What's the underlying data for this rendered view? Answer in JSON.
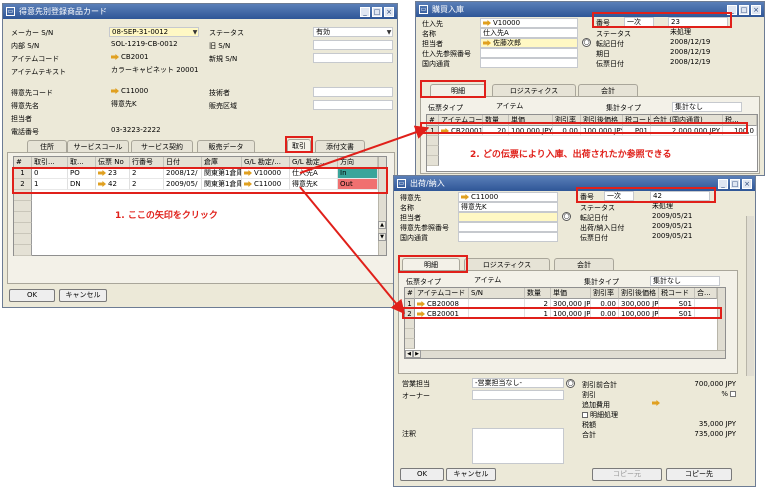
{
  "w1": {
    "title": "得意先別登録商品カード",
    "fields": [
      {
        "l": "メーカー S/N",
        "v": "08-SEP-31-0012",
        "style": "yellow",
        "arrow": false
      },
      {
        "l": "内部 S/N",
        "v": "SOL-1219-CB-0012",
        "style": "plain",
        "arrow": false
      },
      {
        "l": "アイテムコード",
        "v": "CB2001",
        "style": "plain",
        "arrow": true
      },
      {
        "l": "アイテムテキスト",
        "v": "カラーキャビネット 20001",
        "style": "plain",
        "arrow": false
      },
      {
        "l": "得意先コード",
        "v": "C11000",
        "style": "plain",
        "arrow": true
      },
      {
        "l": "得意先名",
        "v": "得意先K",
        "style": "plain",
        "arrow": false
      },
      {
        "l": "担当者",
        "v": "",
        "style": "plain",
        "arrow": false
      },
      {
        "l": "電話番号",
        "v": "03-3223-2222",
        "style": "plain",
        "arrow": false
      }
    ],
    "rfields": [
      {
        "l": "ステータス",
        "v": "有効"
      },
      {
        "l": "旧 S/N",
        "v": ""
      },
      {
        "l": "新規 S/N",
        "v": ""
      },
      {
        "l": "技術者",
        "v": ""
      },
      {
        "l": "販売区域",
        "v": ""
      }
    ],
    "tabs": [
      "住所",
      "サービスコール",
      "サービス契約",
      "販売データ",
      "取引",
      "添付文書"
    ],
    "cols": [
      "#",
      "取引...",
      "取...",
      "伝票 No",
      "行番号",
      "日付",
      "倉庫",
      "G/L 勘定/...",
      "G/L 勘定...",
      "方向"
    ],
    "rows": [
      {
        "n": "1",
        "c": [
          "0",
          "PO",
          "23",
          "2",
          "2008/12/",
          "関東第1倉庫",
          "V10000",
          "仕入先A",
          "In"
        ]
      },
      {
        "n": "2",
        "c": [
          "1",
          "DN",
          "42",
          "2",
          "2009/05/",
          "関東第1倉庫",
          "C11000",
          "得意先K",
          "Out"
        ]
      }
    ],
    "ok": "OK",
    "cancel": "キャンセル"
  },
  "w2": {
    "title": "購買入庫",
    "fields": [
      {
        "l": "仕入先",
        "v": "V10000",
        "arrow": true
      },
      {
        "l": "名称",
        "v": "仕入先A",
        "arrow": false
      },
      {
        "l": "担当者",
        "v": "佐藤次郎",
        "arrow": true
      },
      {
        "l": "仕入先参照番号",
        "v": "",
        "arrow": false
      },
      {
        "l": "国内通貨",
        "v": "",
        "arrow": false
      }
    ],
    "doc": {
      "l": "番号",
      "s": "一次",
      "v": "23"
    },
    "rfields": [
      {
        "l": "ステータス",
        "v": "未処理"
      },
      {
        "l": "転記日付",
        "v": "2008/12/19"
      },
      {
        "l": "期日",
        "v": "2008/12/19"
      },
      {
        "l": "伝票日付",
        "v": "2008/12/19"
      }
    ],
    "tabs": [
      "明細",
      "ロジスティクス",
      "会計"
    ],
    "doctype_l": "伝票タイプ",
    "doctype_v": "アイテム",
    "sum_l": "集計タイプ",
    "sum_v": "集計なし",
    "cols": [
      "#",
      "アイテムコード",
      "数量",
      "単価",
      "割引率",
      "割引後価格",
      "税コード",
      "合計 (国内通貨)",
      "税..."
    ],
    "row": {
      "n": "1",
      "c": [
        "CB20001",
        "20",
        "100,000 JPY",
        "0.00",
        "100,000 JPY",
        "P01",
        "2,000,000 JPY",
        "100,0"
      ]
    }
  },
  "w3": {
    "title": "出荷/納入",
    "fields": [
      {
        "l": "得意先",
        "v": "C11000",
        "arrow": true
      },
      {
        "l": "名称",
        "v": "得意先K",
        "arrow": false
      },
      {
        "l": "担当者",
        "v": "",
        "arrow": false
      },
      {
        "l": "得意先参照番号",
        "v": "",
        "arrow": false
      },
      {
        "l": "国内通貨",
        "v": "",
        "arrow": false
      }
    ],
    "doc": {
      "l": "番号",
      "s": "一次",
      "v": "42"
    },
    "rfields": [
      {
        "l": "ステータス",
        "v": "未処理"
      },
      {
        "l": "転記日付",
        "v": "2009/05/21"
      },
      {
        "l": "出荷/納入日付",
        "v": "2009/05/21"
      },
      {
        "l": "伝票日付",
        "v": "2009/05/21"
      }
    ],
    "tabs": [
      "明細",
      "ロジスティクス",
      "会計"
    ],
    "doctype_l": "伝票タイプ",
    "doctype_v": "アイテム",
    "sum_l": "集計タイプ",
    "sum_v": "集計なし",
    "cols": [
      "#",
      "アイテムコード",
      "S/N",
      "数量",
      "単価",
      "割引率",
      "割引後価格",
      "税コード",
      "合..."
    ],
    "rows": [
      {
        "n": "1",
        "c": [
          "CB20008",
          "",
          "2",
          "300,000 JPY",
          "0.00",
          "300,000 JPY",
          "S01"
        ]
      },
      {
        "n": "2",
        "c": [
          "CB20001",
          "",
          "1",
          "100,000 JPY",
          "0.00",
          "100,000 JPY",
          "S01"
        ]
      }
    ],
    "sales_l": "営業担当",
    "sales_v": "-営業担当なし-",
    "owner_l": "オーナー",
    "remarks_l": "注釈",
    "tot": [
      {
        "l": "割引前合計",
        "v": "700,000 JPY"
      },
      {
        "l": "割引",
        "v": "%"
      },
      {
        "l": "追加費用",
        "v": ""
      },
      {
        "l": "明細処理",
        "v": ""
      },
      {
        "l": "税額",
        "v": "35,000 JPY"
      },
      {
        "l": "合計",
        "v": "735,000 JPY"
      }
    ],
    "ok": "OK",
    "cancel": "キャンセル",
    "copyfrom": "コピー元",
    "copyto": "コピー先"
  },
  "ann": {
    "a1": "1. ここの矢印をクリック",
    "a2": "2. どの伝票により入庫、出荷されたか参照できる"
  },
  "colors": {
    "in": "#3aa59b",
    "out": "#f07070",
    "red": "#e0201a"
  }
}
